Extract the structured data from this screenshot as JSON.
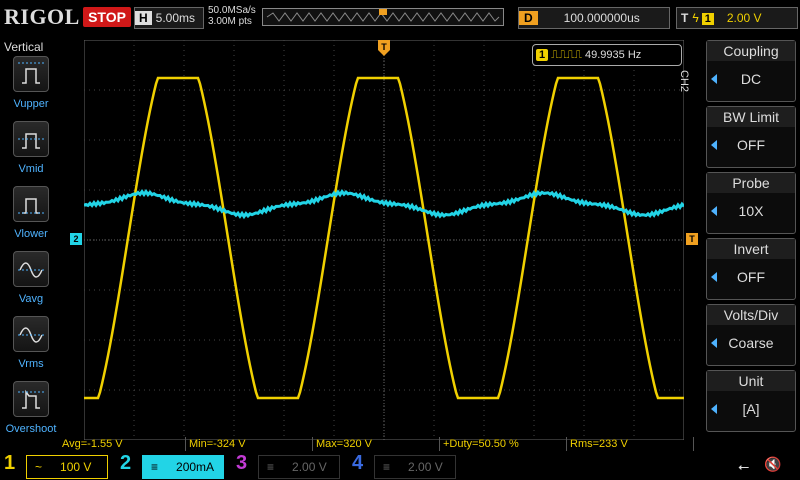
{
  "header": {
    "brand": "RIGOL",
    "run_state": "STOP",
    "timebase_label": "H",
    "timebase": "5.00ms",
    "sample_rate": "50.0MSa/s",
    "memory_depth": "3.00M pts",
    "delay_label": "D",
    "delay": "100.000000us",
    "trigger_label": "T",
    "trigger_channel": "1",
    "trigger_level": "2.00 V"
  },
  "left_panel": {
    "title": "Vertical",
    "items": [
      {
        "label": "Vupper"
      },
      {
        "label": "Vmid"
      },
      {
        "label": "Vlower"
      },
      {
        "label": "Vavg"
      },
      {
        "label": "Vrms"
      },
      {
        "label": "Overshoot"
      }
    ]
  },
  "right_panel": {
    "channel_tag": "CH2",
    "buttons": [
      {
        "title": "Coupling",
        "value": "DC"
      },
      {
        "title": "BW Limit",
        "value": "OFF"
      },
      {
        "title": "Probe",
        "value": "10X"
      },
      {
        "title": "Invert",
        "value": "OFF"
      },
      {
        "title": "Volts/Div",
        "value": "Coarse"
      },
      {
        "title": "Unit",
        "value": "[A]"
      }
    ]
  },
  "frequency_counter": {
    "channel": "1",
    "value": "49.9935 Hz"
  },
  "markers": {
    "trigger_top": "T",
    "ch2_offset": "2",
    "trigger_level": "T"
  },
  "measurements": [
    {
      "text": "Avg=-1.55 V"
    },
    {
      "text": "Min=-324 V"
    },
    {
      "text": "Max=320 V"
    },
    {
      "text": "+Duty=50.50 %"
    },
    {
      "text": "Rms=233 V"
    }
  ],
  "channels": [
    {
      "num": "1",
      "coupling": "~",
      "scale": "100 V",
      "color": "#f0d000"
    },
    {
      "num": "2",
      "coupling": "≡",
      "scale": "200mA",
      "color": "#22d4e6"
    },
    {
      "num": "3",
      "coupling": "≡",
      "scale": "2.00 V",
      "color": "#c23bd4"
    },
    {
      "num": "4",
      "coupling": "≡",
      "scale": "2.00 V",
      "color": "#3a6ae0"
    }
  ],
  "colors": {
    "ch1": "#f0d000",
    "ch2": "#22d4e6",
    "accent": "#4fb3ff",
    "trigger": "#f0a020",
    "stop": "#d01818"
  }
}
